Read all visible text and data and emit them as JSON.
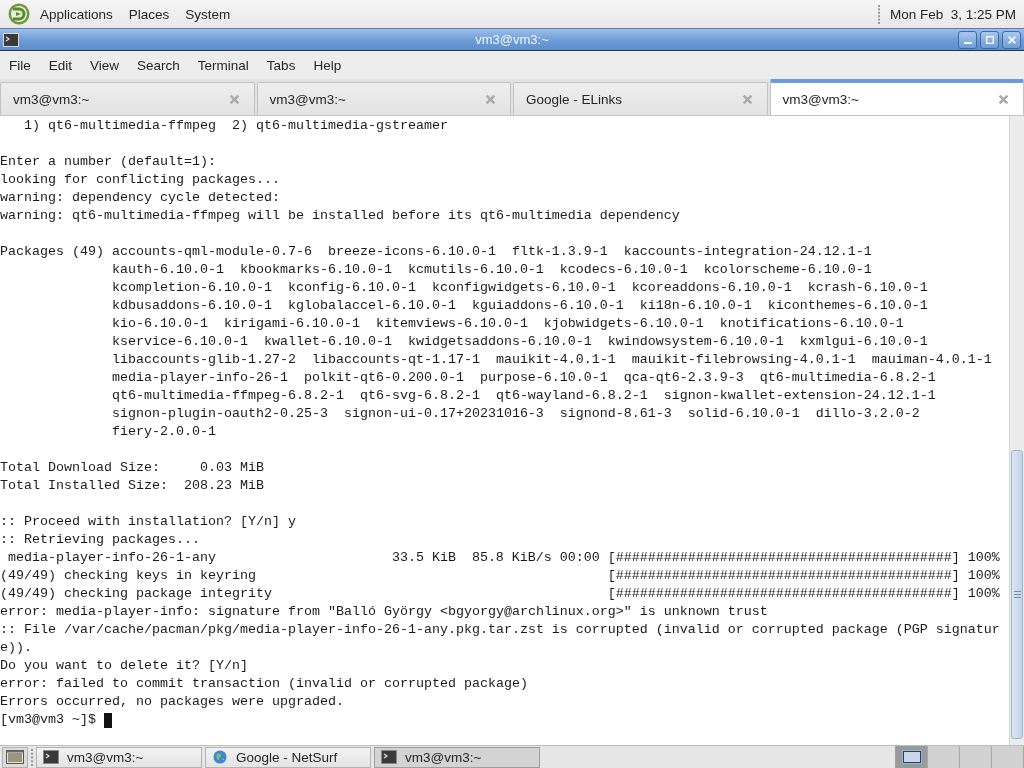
{
  "top_panel": {
    "menus": [
      "Applications",
      "Places",
      "System"
    ],
    "clock": "Mon Feb  3, 1:25 PM"
  },
  "window": {
    "title": "vm3@vm3:~",
    "menu": [
      "File",
      "Edit",
      "View",
      "Search",
      "Terminal",
      "Tabs",
      "Help"
    ]
  },
  "tabs": [
    {
      "label": "vm3@vm3:~",
      "selected": false
    },
    {
      "label": "vm3@vm3:~",
      "selected": false
    },
    {
      "label": "Google - ELinks",
      "selected": false
    },
    {
      "label": "vm3@vm3:~",
      "selected": true
    }
  ],
  "terminal": {
    "blocks": [
      [
        "   1) qt6-multimedia-ffmpeg  2) qt6-multimedia-gstreamer"
      ],
      [
        "Enter a number (default=1):",
        "looking for conflicting packages...",
        "warning: dependency cycle detected:",
        "warning: qt6-multimedia-ffmpeg will be installed before its qt6-multimedia dependency"
      ],
      [
        "Packages (49) accounts-qml-module-0.7-6  breeze-icons-6.10.0-1  fltk-1.3.9-1  kaccounts-integration-24.12.1-1",
        "              kauth-6.10.0-1  kbookmarks-6.10.0-1  kcmutils-6.10.0-1  kcodecs-6.10.0-1  kcolorscheme-6.10.0-1",
        "              kcompletion-6.10.0-1  kconfig-6.10.0-1  kconfigwidgets-6.10.0-1  kcoreaddons-6.10.0-1  kcrash-6.10.0-1",
        "              kdbusaddons-6.10.0-1  kglobalaccel-6.10.0-1  kguiaddons-6.10.0-1  ki18n-6.10.0-1  kiconthemes-6.10.0-1",
        "              kio-6.10.0-1  kirigami-6.10.0-1  kitemviews-6.10.0-1  kjobwidgets-6.10.0-1  knotifications-6.10.0-1",
        "              kservice-6.10.0-1  kwallet-6.10.0-1  kwidgetsaddons-6.10.0-1  kwindowsystem-6.10.0-1  kxmlgui-6.10.0-1",
        "              libaccounts-glib-1.27-2  libaccounts-qt-1.17-1  mauikit-4.0.1-1  mauikit-filebrowsing-4.0.1-1  mauiman-4.0.1-1",
        "              media-player-info-26-1  polkit-qt6-0.200.0-1  purpose-6.10.0-1  qca-qt6-2.3.9-3  qt6-multimedia-6.8.2-1",
        "              qt6-multimedia-ffmpeg-6.8.2-1  qt6-svg-6.8.2-1  qt6-wayland-6.8.2-1  signon-kwallet-extension-24.12.1-1",
        "              signon-plugin-oauth2-0.25-3  signon-ui-0.17+20231016-3  signond-8.61-3  solid-6.10.0-1  dillo-3.2.0-2",
        "              fiery-2.0.0-1"
      ],
      [
        "Total Download Size:     0.03 MiB",
        "Total Installed Size:  208.23 MiB"
      ],
      [
        ":: Proceed with installation? [Y/n] y",
        ":: Retrieving packages...",
        " media-player-info-26-1-any                      33.5 KiB  85.8 KiB/s 00:00 [##########################################] 100%",
        "(49/49) checking keys in keyring                                            [##########################################] 100%",
        "(49/49) checking package integrity                                          [##########################################] 100%",
        "error: media-player-info: signature from \"Balló György <bgyorgy@archlinux.org>\" is unknown trust",
        ":: File /var/cache/pacman/pkg/media-player-info-26-1-any.pkg.tar.zst is corrupted (invalid or corrupted package (PGP signatur",
        "e)).",
        "Do you want to delete it? [Y/n]",
        "error: failed to commit transaction (invalid or corrupted package)",
        "Errors occurred, no packages were upgraded.",
        "[vm3@vm3 ~]$"
      ]
    ],
    "cursor": true
  },
  "taskbar": {
    "tasks": [
      {
        "label": "vm3@vm3:~",
        "kind": "terminal",
        "selected": false
      },
      {
        "label": "Google - NetSurf",
        "kind": "browser",
        "selected": false
      },
      {
        "label": "vm3@vm3:~",
        "kind": "terminal",
        "selected": true
      }
    ],
    "workspaces": [
      {
        "selected": true,
        "has_windows": true
      },
      {
        "selected": false,
        "has_windows": false
      },
      {
        "selected": false,
        "has_windows": false
      },
      {
        "selected": false,
        "has_windows": false
      }
    ]
  }
}
